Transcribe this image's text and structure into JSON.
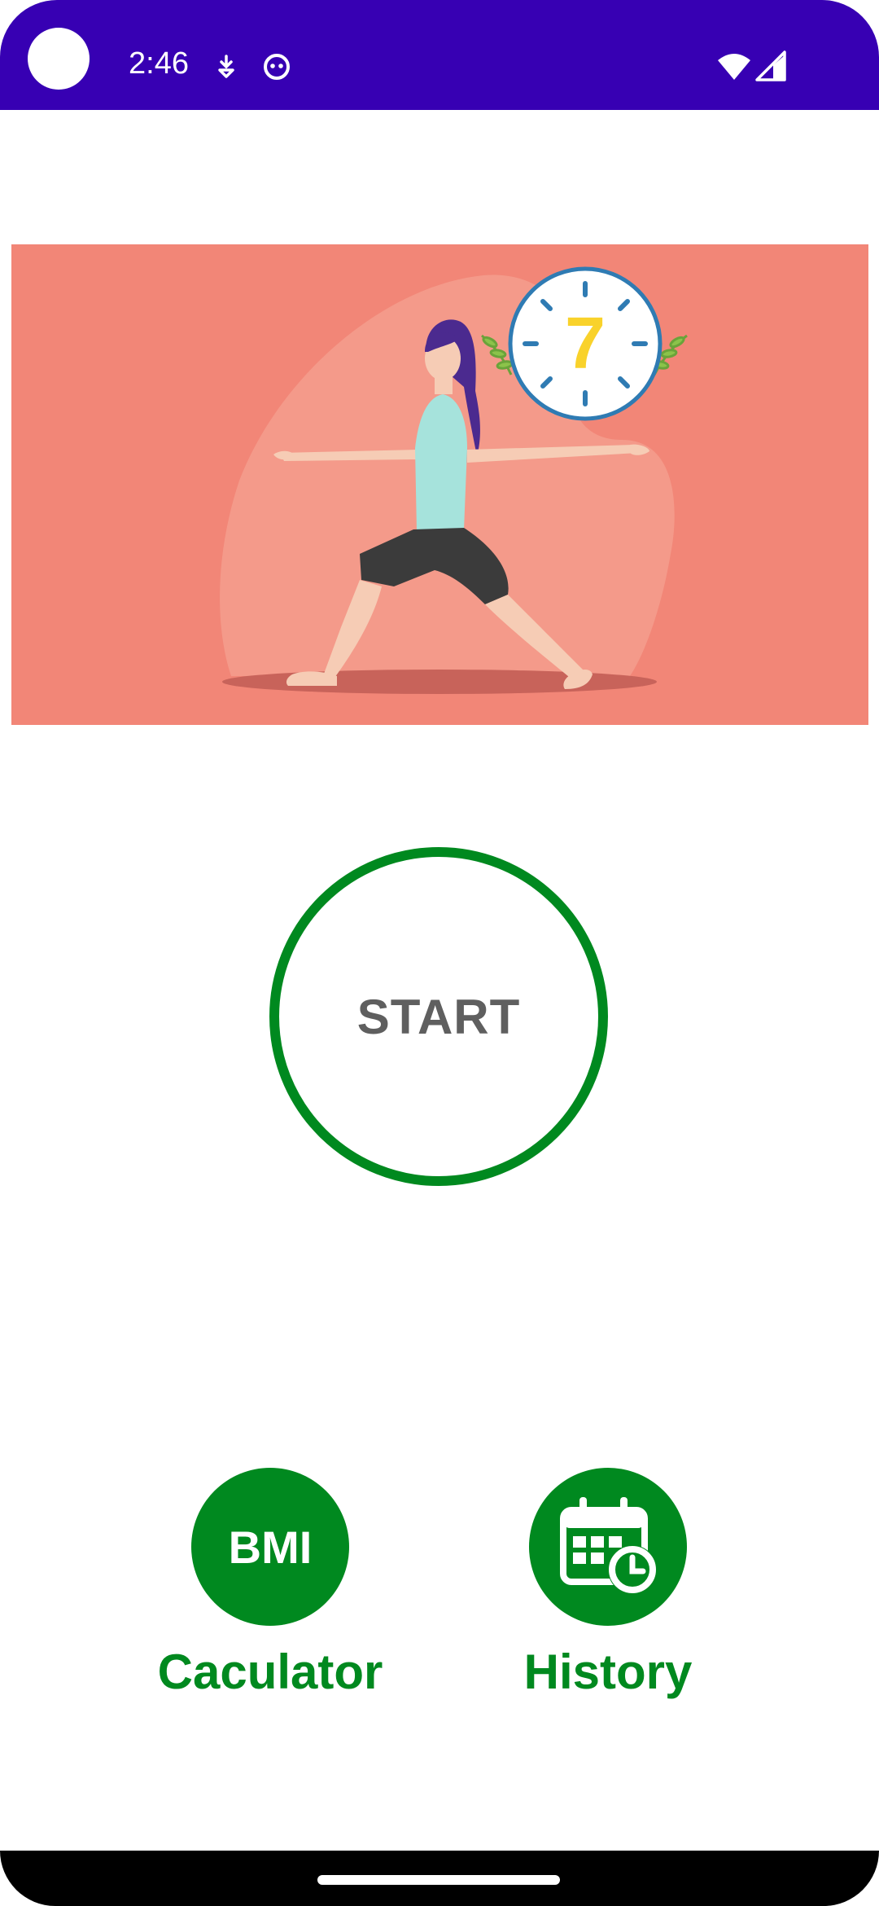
{
  "status_bar": {
    "time": "2:46",
    "icons": [
      "download-badge-icon",
      "face-notification-icon",
      "wifi-icon",
      "signal-icon"
    ],
    "background": "#3700b3"
  },
  "banner": {
    "background": "#f28677",
    "timer_number": "7",
    "timer_number_color": "#f9d22b",
    "timer_ring_color": "#2f7bb3"
  },
  "start": {
    "label": "START",
    "ring_color": "#00891f",
    "text_color": "#5f5f5f"
  },
  "bmi": {
    "icon_label": "BMI",
    "caption": "Caculator"
  },
  "history": {
    "icon": "calendar-clock-icon",
    "caption": "History"
  },
  "accent": "#00891f"
}
